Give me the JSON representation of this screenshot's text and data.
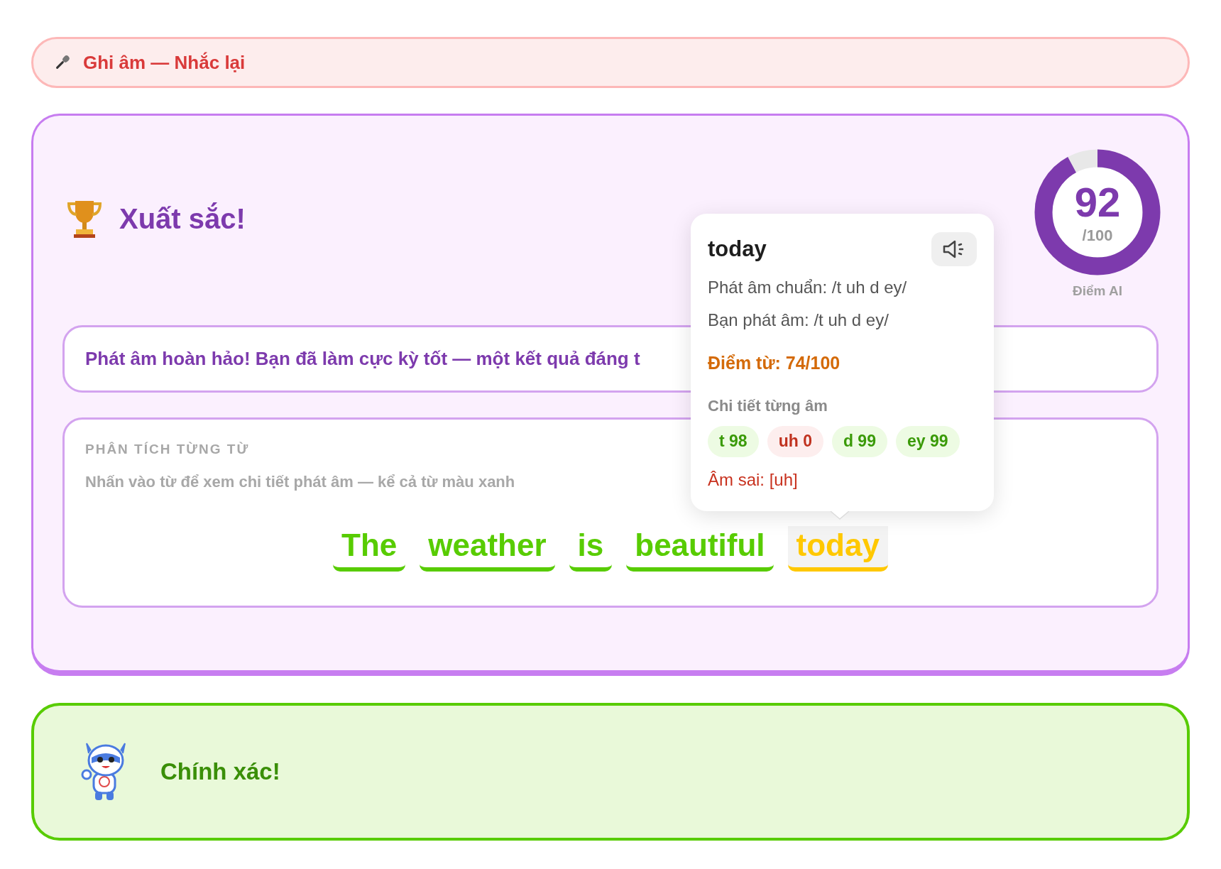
{
  "recording_bar": {
    "label": "Ghi âm — Nhắc lại"
  },
  "result": {
    "title": "Xuất sắc!",
    "score": {
      "value": "92",
      "max": "/100",
      "label": "Điểm AI",
      "level": 0.92
    },
    "feedback": "Phát âm hoàn hảo! Bạn đã làm cực kỳ tốt — một kết quả đáng t",
    "analysis": {
      "heading": "PHÂN TÍCH TỪNG TỪ",
      "hint": "Nhấn vào từ để xem chi tiết phát âm — kể cả từ màu xanh",
      "words": [
        {
          "text": "The",
          "color": "#58cc02",
          "selected": false
        },
        {
          "text": "weather",
          "color": "#58cc02",
          "selected": false
        },
        {
          "text": "is",
          "color": "#58cc02",
          "selected": false
        },
        {
          "text": "beautiful",
          "color": "#58cc02",
          "selected": false
        },
        {
          "text": "today",
          "color": "#ffc800",
          "selected": true
        }
      ]
    },
    "popup": {
      "word": "today",
      "reference": "Phát âm chuẩn: /t uh d ey/",
      "yours": "Bạn phát âm: /t uh d ey/",
      "word_score": "Điểm từ: 74/100",
      "details_heading": "Chi tiết từng âm",
      "phonemes": [
        {
          "text": "t 98",
          "correct": true
        },
        {
          "text": "uh 0",
          "correct": false
        },
        {
          "text": "d 99",
          "correct": true
        },
        {
          "text": "ey 99",
          "correct": true
        }
      ],
      "error": "Âm sai: [uh]"
    }
  },
  "verdict": {
    "text": "Chính xác!"
  }
}
